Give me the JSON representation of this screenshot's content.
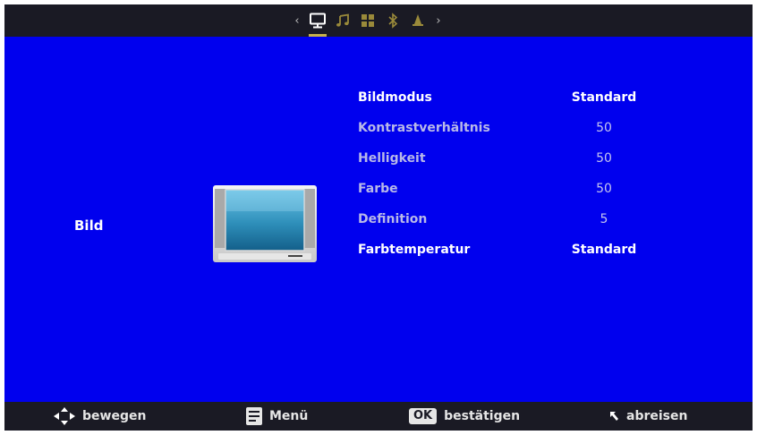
{
  "topbar": {
    "left_arrow": "‹",
    "right_arrow": "›",
    "tabs": [
      {
        "icon": "monitor-icon",
        "active": true
      },
      {
        "icon": "music-note-icon",
        "active": false
      },
      {
        "icon": "grid-icon",
        "active": false
      },
      {
        "icon": "bluetooth-icon",
        "active": false
      },
      {
        "icon": "bell-icon",
        "active": false
      }
    ]
  },
  "section": {
    "title": "Bild"
  },
  "settings": [
    {
      "label": "Bildmodus",
      "value": "Standard"
    },
    {
      "label": "Kontrastverhältnis",
      "value": "50"
    },
    {
      "label": "Helligkeit",
      "value": "50"
    },
    {
      "label": "Farbe",
      "value": "50"
    },
    {
      "label": "Definition",
      "value": "5"
    },
    {
      "label": "Farbtemperatur",
      "value": "Standard"
    }
  ],
  "footer": {
    "move": "bewegen",
    "menu": "Menü",
    "ok_key": "OK",
    "confirm": "bestätigen",
    "back": "abreisen"
  },
  "colors": {
    "background": "#0000ee",
    "bar": "#1a1a24",
    "accent": "#c8b24a"
  }
}
